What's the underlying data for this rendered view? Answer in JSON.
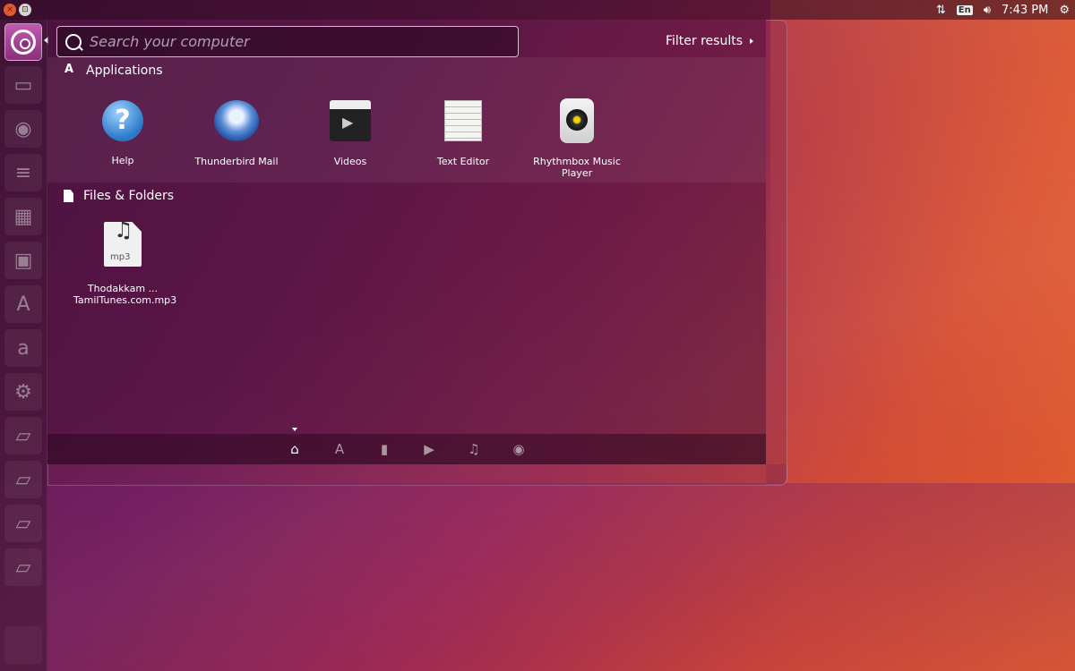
{
  "top_panel": {
    "time": "7:43 PM",
    "keyboard_layout": "En",
    "icons": [
      "network-transfer-icon",
      "volume-icon",
      "power-gear-icon"
    ]
  },
  "window_controls": {
    "close": "×",
    "maximize": "⊡"
  },
  "launcher": {
    "items": [
      "dash-home",
      "files",
      "firefox",
      "libreoffice-writer",
      "libreoffice-calc",
      "libreoffice-impress",
      "software-center",
      "amazon",
      "system-settings",
      "drive-1",
      "drive-2",
      "drive-3",
      "drive-4",
      "trash"
    ],
    "amazon_glyph": "a"
  },
  "search": {
    "placeholder": "Search your computer",
    "value": ""
  },
  "filter": {
    "label": "Filter results"
  },
  "categories": {
    "applications": {
      "title": "Applications",
      "items": [
        {
          "label": "Help",
          "icon": "help-icon",
          "glyph": "?"
        },
        {
          "label": "Thunderbird Mail",
          "icon": "thunderbird-icon"
        },
        {
          "label": "Videos",
          "icon": "videos-icon"
        },
        {
          "label": "Text Editor",
          "icon": "text-editor-icon"
        },
        {
          "label": "Rhythmbox Music Player",
          "icon": "rhythmbox-icon"
        }
      ]
    },
    "files": {
      "title": "Files & Folders",
      "items": [
        {
          "label": "Thodakkam ... TamilTunes.com.mp3",
          "icon": "mp3-file-icon",
          "badge": "mp3",
          "glyph": "♫"
        }
      ]
    }
  },
  "scope_bar": {
    "lenses": [
      {
        "name": "home",
        "glyph": "⌂"
      },
      {
        "name": "applications",
        "glyph": "A"
      },
      {
        "name": "files",
        "glyph": "▮"
      },
      {
        "name": "videos",
        "glyph": "▶"
      },
      {
        "name": "music",
        "glyph": "♫"
      },
      {
        "name": "photos",
        "glyph": "◉"
      }
    ]
  }
}
